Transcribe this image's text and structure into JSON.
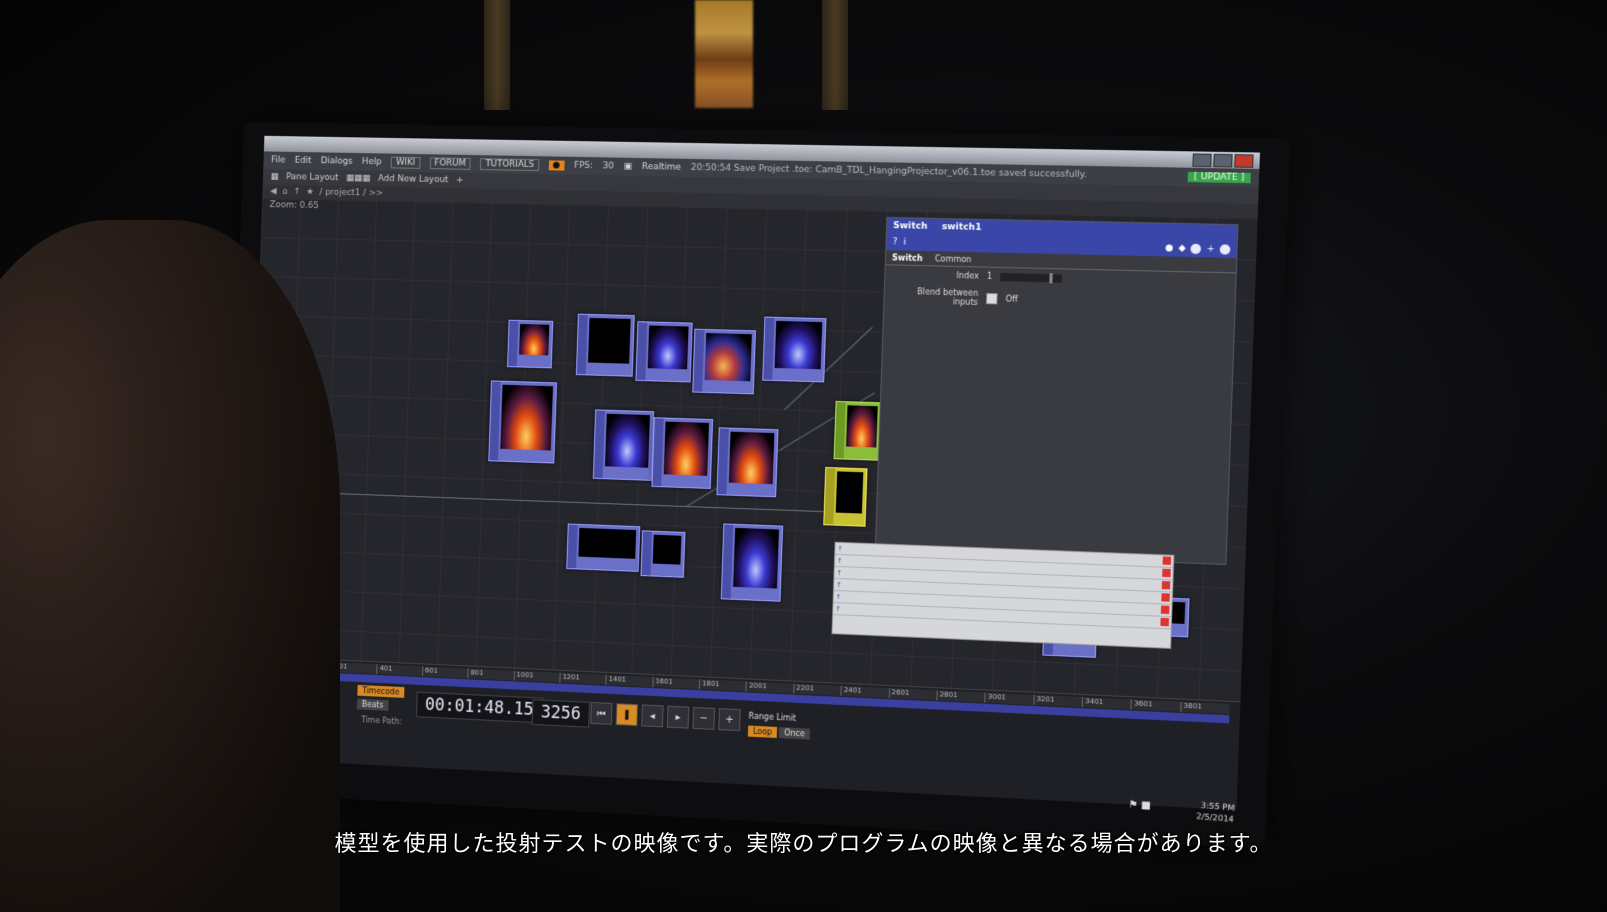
{
  "window": {
    "menu_items": [
      "File",
      "Edit",
      "Dialogs",
      "Help"
    ],
    "links": [
      "WIKI",
      "FORUM",
      "TUTORIALS"
    ],
    "fps_label": "FPS:",
    "fps_value": "30",
    "realtime_label": "Realtime",
    "status_message": "20:50:54 Save Project .toe: CamB_TDL_HangingProjector_v06.1.toe saved successfully.",
    "update_button": "[ UPDATE ]"
  },
  "toolbar": {
    "pane_layout": "Pane Layout",
    "add_layout": "Add New Layout",
    "path": "/ project1 / >>"
  },
  "network": {
    "zoom_label": "Zoom: 0.65"
  },
  "param_panel": {
    "op_type": "Switch",
    "op_name": "switch1",
    "tabs": [
      "Switch",
      "Common"
    ],
    "index_label": "Index",
    "index_value": "1",
    "blend_label": "Blend between inputs",
    "blend_value": "Off"
  },
  "timeline": {
    "timecode": "00:01:48.15",
    "frame": "3256",
    "timecode_button": "Timecode",
    "beats_button": "Beats",
    "time_path": "Time Path:",
    "range_limit_label": "Range Limit",
    "range_buttons": [
      "Loop",
      "Once"
    ],
    "ruler_ticks": [
      "201",
      "401",
      "601",
      "801",
      "1001",
      "1201",
      "1401",
      "1601",
      "1801",
      "2001",
      "2201",
      "2401",
      "2601",
      "2801",
      "3001",
      "3201",
      "3401",
      "3601",
      "3801"
    ]
  },
  "taskbar": {
    "time": "3:55 PM",
    "date": "2/5/2014"
  },
  "subtitle": "模型を使用した投射テストの映像です。実際のプログラムの映像と異なる場合があります。"
}
